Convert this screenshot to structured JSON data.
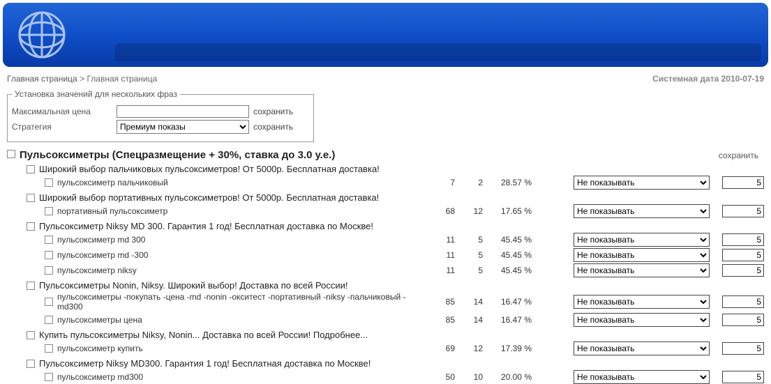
{
  "breadcrumb": {
    "home": "Главная страница",
    "sep": ">",
    "current": "Главная страница"
  },
  "sysdate": {
    "label": "Системная дата",
    "value": "2010-07-19"
  },
  "settings": {
    "legend": "Установка значений для нескольких фраз",
    "maxprice_label": "Максимальная цена",
    "maxprice_value": "",
    "save_label": "сохранить",
    "strategy_label": "Стратегия",
    "strategy_value": "Премиум показы"
  },
  "group": {
    "title": "Пульсоксиметры (Спецразмещение + 30%, ставка до 3.0 у.е.)",
    "save_label": "сохранить"
  },
  "dropdown_default": "Не показывать",
  "numbox_default": "5",
  "ads": [
    {
      "title": "Широкий выбор пальчиковых пульсоксиметров! От 5000р. Бесплатная доставка!",
      "phrases": [
        {
          "text": "пульсоксиметр пальчиковый",
          "v1": "7",
          "v2": "2",
          "pct": "28.57 %"
        }
      ]
    },
    {
      "title": "Широкий выбор портативных пульсоксиметров! От 5000р. Бесплатная доставка!",
      "phrases": [
        {
          "text": "портативный пульсоксиметр",
          "v1": "68",
          "v2": "12",
          "pct": "17.65 %"
        }
      ]
    },
    {
      "title": "Пульсоксиметр Niksy MD 300. Гарантия 1 год! Бесплатная доставка по Москве!",
      "phrases": [
        {
          "text": "пульсоксиметр md 300",
          "v1": "11",
          "v2": "5",
          "pct": "45.45 %"
        },
        {
          "text": "пульсоксиметр md -300",
          "v1": "11",
          "v2": "5",
          "pct": "45.45 %"
        },
        {
          "text": "пульсоксиметр niksy",
          "v1": "11",
          "v2": "5",
          "pct": "45.45 %"
        }
      ]
    },
    {
      "title": "Пульсоксиметры Nonin, Niksy. Широкий выбор! Доставка по всей России!",
      "phrases": [
        {
          "text": "пульсоксиметры -покупать -цена -md -nonin -окситест -портативный -niksy -пальчиковый -md300",
          "v1": "85",
          "v2": "14",
          "pct": "16.47 %"
        },
        {
          "text": "пульсоксиметры цена",
          "v1": "85",
          "v2": "14",
          "pct": "16.47 %"
        }
      ]
    },
    {
      "title": "Купить пульсоксиметры Niksy, Nonin... Доставка по всей России! Подробнее...",
      "phrases": [
        {
          "text": "пульсоксиметр купить",
          "v1": "69",
          "v2": "12",
          "pct": "17.39 %"
        }
      ]
    },
    {
      "title": "Пульсоксиметр Niksy MD300. Гарантия 1 год! Бесплатная доставка по Москве!",
      "phrases": [
        {
          "text": "пульсоксиметр md300",
          "v1": "50",
          "v2": "10",
          "pct": "20.00 %"
        }
      ]
    }
  ]
}
